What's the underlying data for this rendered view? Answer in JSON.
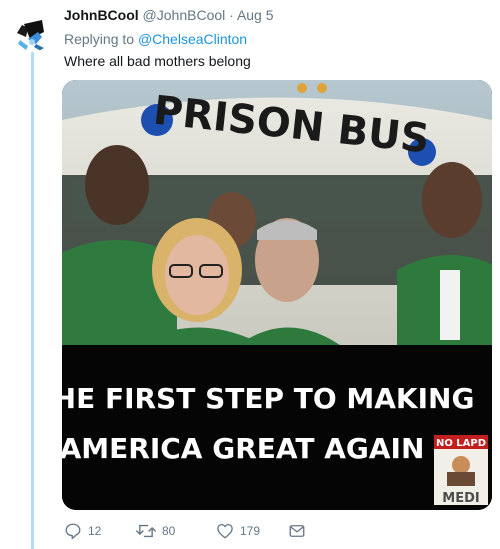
{
  "tweet": {
    "display_name": "JohnBCool",
    "handle": "@JohnBCool",
    "separator": "·",
    "date": "Aug 5",
    "replying_prefix": "Replying to",
    "replying_to": "@ChelseaClinton",
    "text": "Where all bad mothers belong"
  },
  "media": {
    "bus_sign": "PRISON BUS",
    "caption_line1": "THE FIRST STEP TO MAKING",
    "caption_line2": "AMERICA GREAT AGAIN",
    "watermark_top": "NO LAPD",
    "watermark_bottom": "MEDI"
  },
  "actions": {
    "reply_count": "12",
    "retweet_count": "80",
    "like_count": "179"
  },
  "colors": {
    "link": "#1b95e0",
    "muted": "#657786",
    "thread_line": "#b9dcf5"
  }
}
